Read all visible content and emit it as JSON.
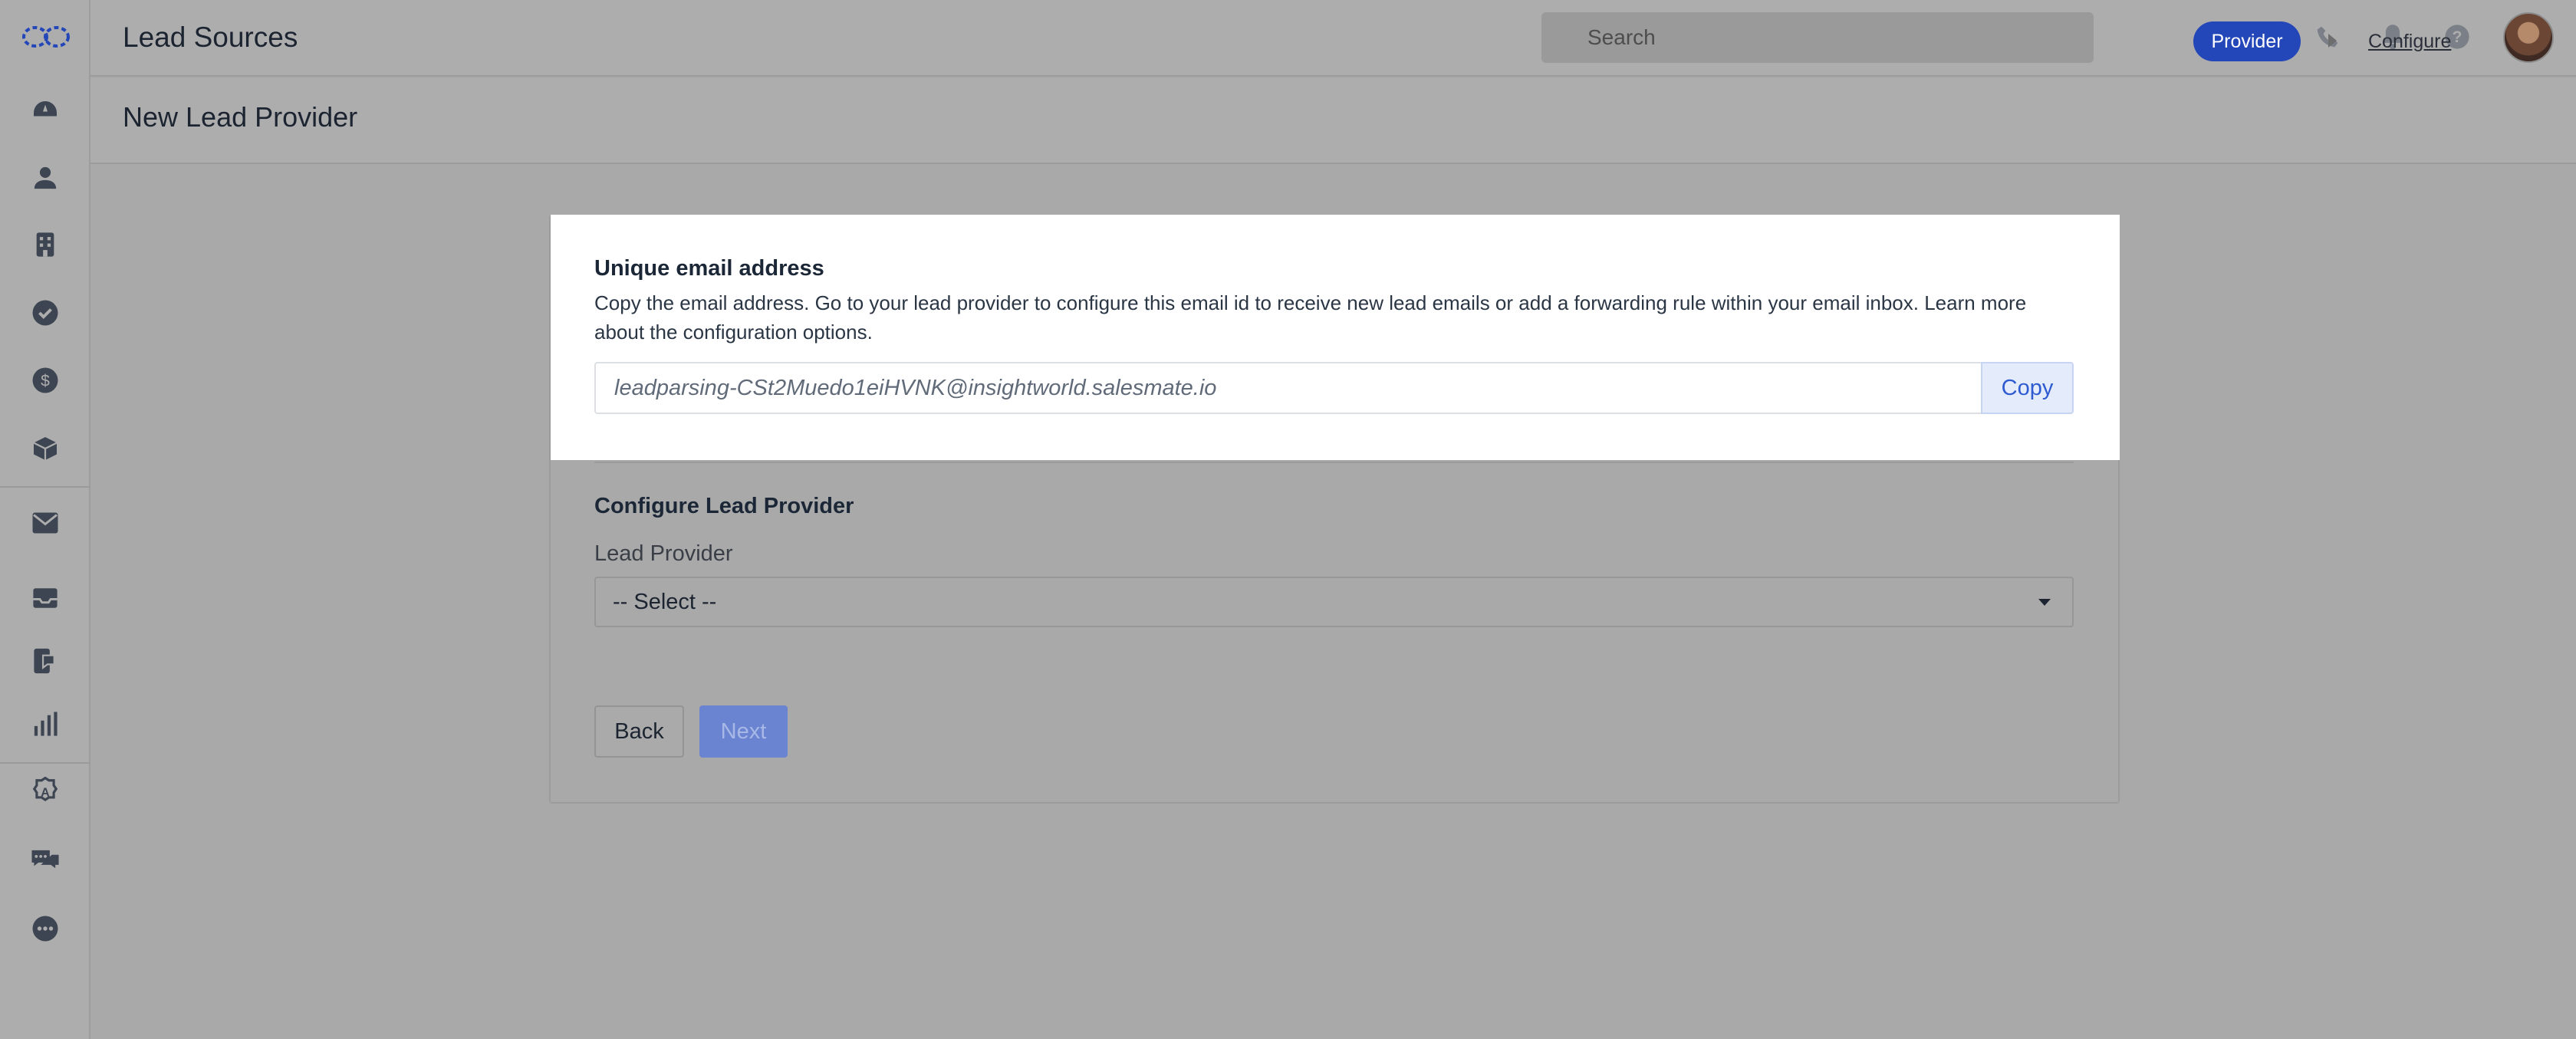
{
  "app": {
    "title": "Lead Sources"
  },
  "search": {
    "placeholder": "Search"
  },
  "topbar_icons": [
    "add-icon",
    "phone-icon",
    "bell-icon",
    "help-icon",
    "avatar"
  ],
  "sidebar": {
    "items": [
      "dashboard-icon",
      "contacts-icon",
      "companies-icon",
      "tasks-icon",
      "deals-icon",
      "products-icon",
      "email-icon",
      "inbox-icon",
      "campaign-icon",
      "reports-icon",
      "automation-icon",
      "chat-icon",
      "more-icon"
    ]
  },
  "subheader": {
    "title": "New Lead Provider",
    "steps": [
      "Provider",
      "Configure"
    ]
  },
  "email_section": {
    "title": "Unique email address",
    "description": "Copy the email address. Go to your lead provider to configure this email id to receive new lead emails or add a forwarding rule within your email inbox. Learn more about the configuration options.",
    "email": "leadparsing-CSt2Muedo1eiHVNK@insightworld.salesmate.io",
    "copy_label": "Copy"
  },
  "configure_section": {
    "title": "Configure Lead Provider",
    "field_label": "Lead Provider",
    "select_value": "-- Select --"
  },
  "actions": {
    "back_label": "Back",
    "next_label": "Next"
  },
  "colors": {
    "accent": "#2346b8",
    "add_green": "#1f9a3a",
    "copy_blue": "#2f5bd1",
    "overlay_gray": "#a9a9a9"
  }
}
